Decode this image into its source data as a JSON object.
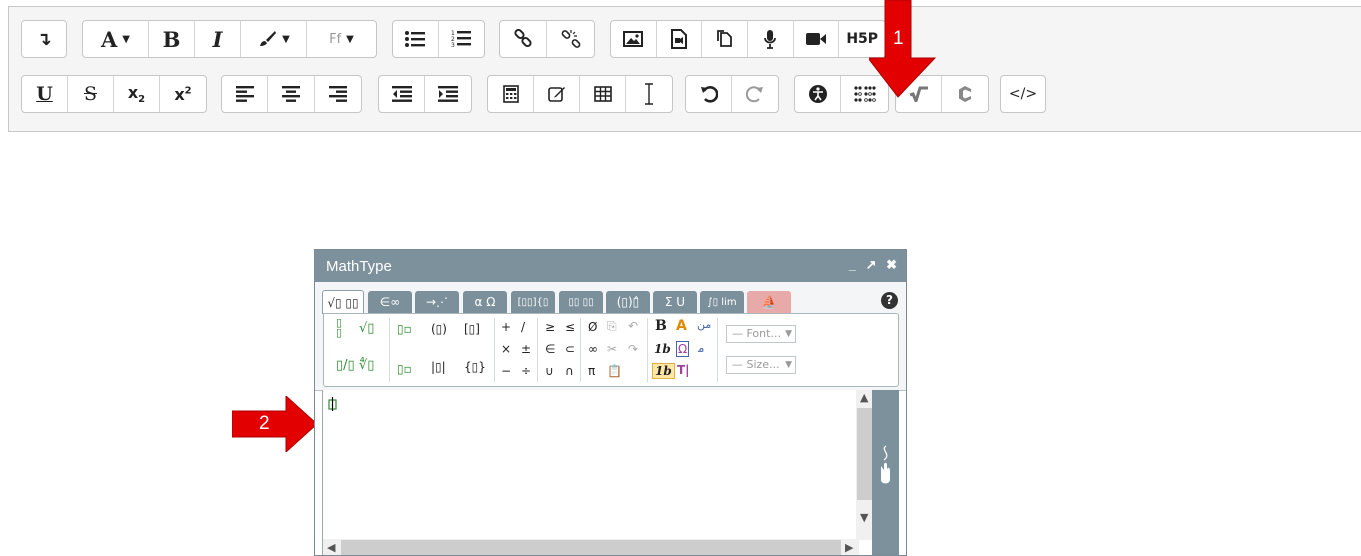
{
  "toolbar": {
    "row1": [
      {
        "buttons": [
          {
            "name": "toolbar-toggle-button",
            "icon": "collapse-arrow-icon",
            "glyph": "↴"
          }
        ]
      },
      {
        "buttons": [
          {
            "name": "font-color-button",
            "icon": "font-color-icon",
            "label": "A"
          },
          {
            "name": "bold-button",
            "icon": "bold-icon",
            "label": "B"
          },
          {
            "name": "italic-button",
            "icon": "italic-icon",
            "label": "I"
          },
          {
            "name": "background-color-button",
            "icon": "paintbrush-icon"
          },
          {
            "name": "font-family-button",
            "icon": "font-family-icon",
            "label": "Ff"
          }
        ]
      },
      {
        "buttons": [
          {
            "name": "unordered-list-button",
            "icon": "bullet-list-icon"
          },
          {
            "name": "ordered-list-button",
            "icon": "numbered-list-icon"
          }
        ]
      },
      {
        "buttons": [
          {
            "name": "link-button",
            "icon": "link-icon"
          },
          {
            "name": "unlink-button",
            "icon": "unlink-icon"
          }
        ]
      },
      {
        "buttons": [
          {
            "name": "insert-image-button",
            "icon": "image-icon"
          },
          {
            "name": "insert-media-button",
            "icon": "media-file-icon"
          },
          {
            "name": "manage-files-button",
            "icon": "files-icon"
          },
          {
            "name": "record-audio-button",
            "icon": "microphone-icon"
          },
          {
            "name": "record-video-button",
            "icon": "video-camera-icon"
          },
          {
            "name": "h5p-button",
            "icon": "h5p-icon",
            "label": "H5P"
          }
        ]
      }
    ],
    "row2": [
      {
        "buttons": [
          {
            "name": "underline-button",
            "icon": "underline-icon",
            "label": "U"
          },
          {
            "name": "strikethrough-button",
            "icon": "strikethrough-icon",
            "label": "S"
          },
          {
            "name": "subscript-button",
            "icon": "subscript-icon",
            "label": "x",
            "sub": "2"
          },
          {
            "name": "superscript-button",
            "icon": "superscript-icon",
            "label": "x",
            "sup": "2"
          }
        ]
      },
      {
        "buttons": [
          {
            "name": "align-left-button",
            "icon": "align-left-icon"
          },
          {
            "name": "align-center-button",
            "icon": "align-center-icon"
          },
          {
            "name": "align-right-button",
            "icon": "align-right-icon"
          }
        ]
      },
      {
        "buttons": [
          {
            "name": "outdent-button",
            "icon": "outdent-icon"
          },
          {
            "name": "indent-button",
            "icon": "indent-icon"
          }
        ]
      },
      {
        "buttons": [
          {
            "name": "equation-editor-button",
            "icon": "calculator-icon"
          },
          {
            "name": "edit-button",
            "icon": "edit-icon"
          },
          {
            "name": "table-button",
            "icon": "table-icon"
          },
          {
            "name": "clear-formatting-button",
            "icon": "text-cursor-icon"
          }
        ]
      },
      {
        "buttons": [
          {
            "name": "undo-button",
            "icon": "undo-icon"
          },
          {
            "name": "redo-button",
            "icon": "redo-icon"
          }
        ]
      },
      {
        "buttons": [
          {
            "name": "accessibility-checker-button",
            "icon": "accessibility-icon"
          },
          {
            "name": "screenreader-helper-button",
            "icon": "braille-icon"
          }
        ]
      },
      {
        "buttons": [
          {
            "name": "mathtype-button",
            "icon": "mathtype-sqrt-icon"
          },
          {
            "name": "chemtype-button",
            "icon": "chemtype-c-icon"
          }
        ]
      },
      {
        "buttons": [
          {
            "name": "html-button",
            "icon": "code-icon",
            "label": "</>"
          }
        ]
      }
    ]
  },
  "annotations": {
    "arrow1_label": "1",
    "arrow2_label": "2",
    "arrow_color": "#e30000"
  },
  "mathtype": {
    "title": "MathType",
    "window_controls": "_ ↗ ✖",
    "help": "?",
    "tabs": [
      {
        "label": "√▯ ▯▯",
        "active": true
      },
      {
        "label": "∈∞"
      },
      {
        "label": "→⋰"
      },
      {
        "label": "α Ω"
      },
      {
        "label": "[▯▯]{▯"
      },
      {
        "label": "▯▯ ▯▯"
      },
      {
        "label": "(▯)▯̂"
      },
      {
        "label": "Σ U"
      },
      {
        "label": "∫▯ lim"
      },
      {
        "label": "⛵",
        "pink": true
      }
    ],
    "palette": {
      "font_placeholder": "— Font...",
      "size_placeholder": "— Size...",
      "bold": "B",
      "italic_b": "1b",
      "italic_b2": "1b",
      "operators": {
        "plus": "+",
        "slash": "/",
        "times": "×",
        "pm": "±",
        "minus": "−",
        "div": "÷",
        "geq": "≥",
        "leq": "≤",
        "in": "∈",
        "subset": "⊂",
        "union": "∪",
        "intersect": "∩",
        "empty": "Ø",
        "infinity": "∞",
        "pi": "π"
      }
    },
    "colors": {
      "accent": "#7d919d",
      "pink_tab": "#e8a9a9",
      "green": "#2e8b2e"
    }
  }
}
